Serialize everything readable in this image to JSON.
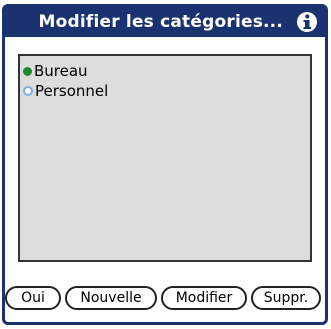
{
  "dialog": {
    "title": "Modifier les catégories...",
    "info_icon": "info-icon"
  },
  "categories": [
    {
      "label": "Bureau",
      "color": "#1f8a2e"
    },
    {
      "label": "Personnel",
      "color": "#7ab0e8"
    }
  ],
  "buttons": {
    "ok": "Oui",
    "new": "Nouvelle",
    "edit": "Modifier",
    "delete": "Suppr."
  },
  "colors": {
    "title_bar": "#1a3370",
    "list_background": "#dddddd"
  }
}
